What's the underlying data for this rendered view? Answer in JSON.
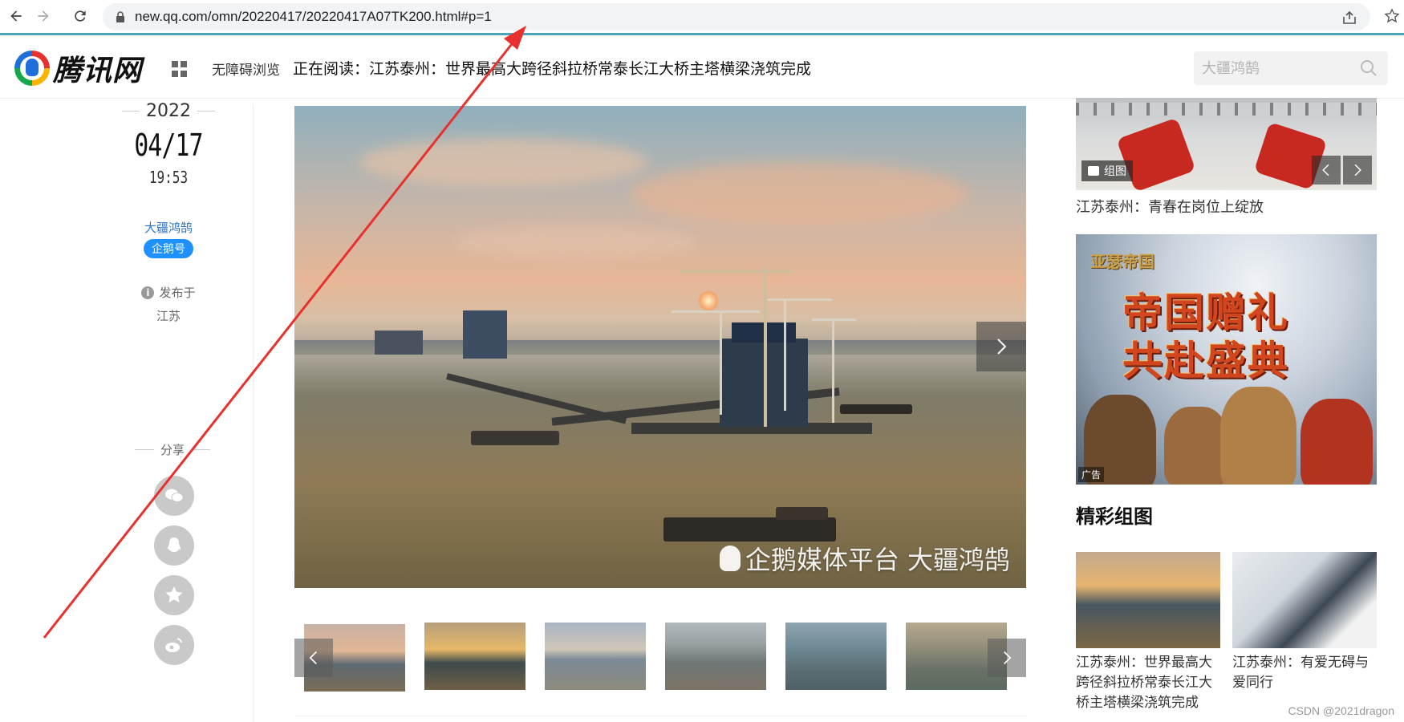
{
  "browser": {
    "url": "new.qq.com/omn/20220417/20220417A07TK200.html#p=1"
  },
  "header": {
    "logo_text": "腾讯网",
    "accessibility_label": "无障碍浏览",
    "reading_prefix": "正在阅读：",
    "reading_title": "江苏泰州：世界最高大跨径斜拉桥常泰长江大桥主塔横梁浇筑完成",
    "search_placeholder": "大疆鸿鹄"
  },
  "meta": {
    "year": "2022",
    "date": "04/17",
    "time": "19:53",
    "author": "大疆鸿鹄",
    "author_badge": "企鹅号",
    "published_label": "发布于",
    "published_place": "江苏",
    "share_label": "分享"
  },
  "gallery": {
    "watermark": "企鹅媒体平台 大疆鸿鹄",
    "thumbnail_count": 6,
    "active_thumbnail": 1
  },
  "right": {
    "group_tag": "组图",
    "top_caption": "江苏泰州：青春在岗位上绽放",
    "ad_logo": "亚瑟帝国",
    "ad_line1": "帝国赠礼",
    "ad_line2": "共赴盛典",
    "ad_tag": "广告",
    "section_title": "精彩组图",
    "cards": [
      {
        "caption": "江苏泰州：世界最高大跨径斜拉桥常泰长江大桥主塔横梁浇筑完成"
      },
      {
        "caption": "江苏泰州：有爱无碍与爱同行"
      }
    ]
  },
  "footer": {
    "watermark": "CSDN @2021dragon"
  },
  "colors": {
    "accent_blue": "#1e90ff",
    "annotation_red": "#e8312f",
    "address_bar_underline": "#49a6b9"
  }
}
